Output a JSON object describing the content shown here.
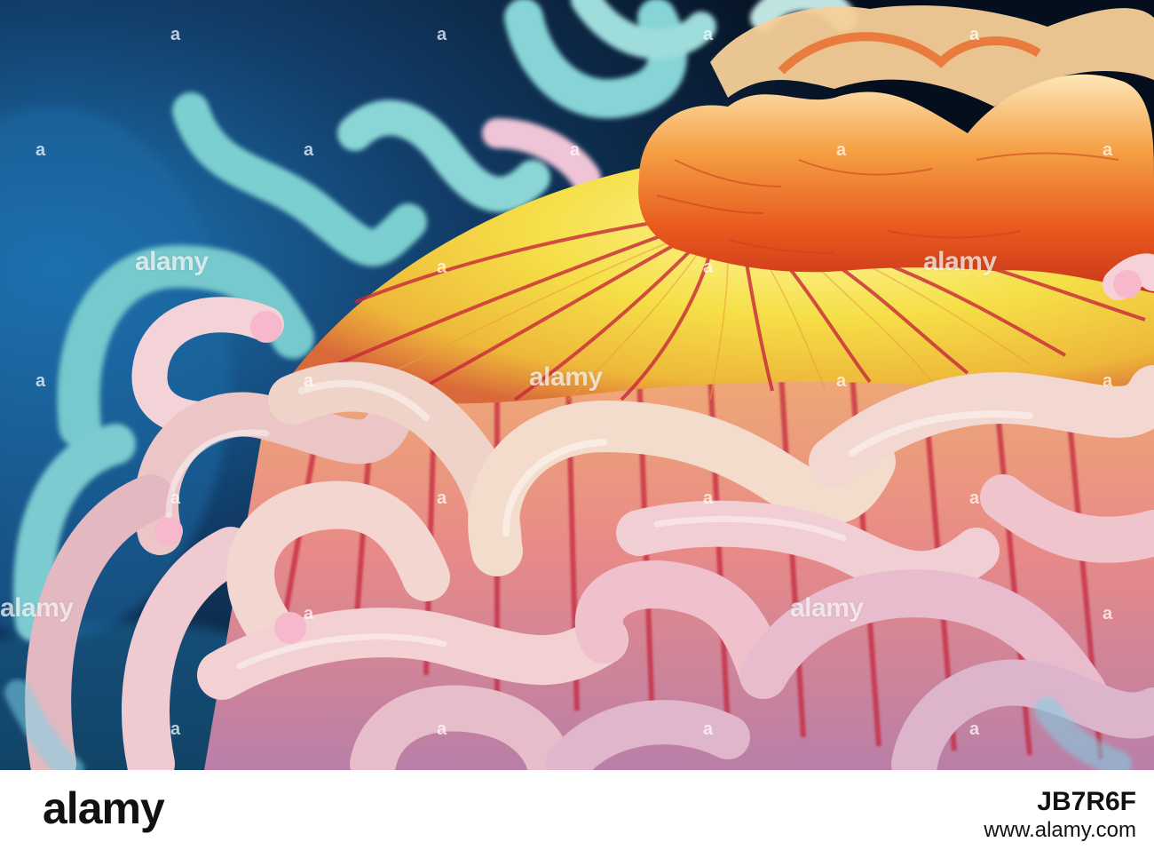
{
  "watermark": {
    "brand": "alamy",
    "letter": "a"
  },
  "footer": {
    "logo": "alamy",
    "image_id": "JB7R6F",
    "url": "www.alamy.com"
  },
  "colors": {
    "background_deep": "#0a1a30",
    "water_blue": "#1e6fa8",
    "oral_disc_yellow": "#f4e04a",
    "mouth_orange": "#e8652a",
    "stripe_red": "#c8283a",
    "tentacle_pink": "#f0c8c8",
    "tentacle_cyan": "#8fd6d8"
  }
}
